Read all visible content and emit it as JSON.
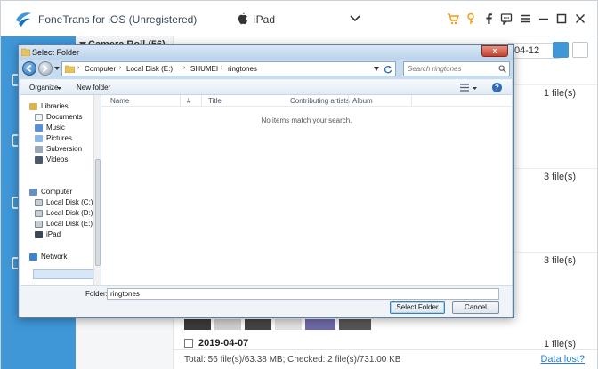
{
  "app": {
    "title": "FoneTrans for iOS (Unregistered)",
    "device": "iPad",
    "accent_color": "#3f97d8",
    "album": "Camera Roll (56)"
  },
  "content": {
    "date_filter": "04-12",
    "file_counts": [
      "1 file(s)",
      "3 file(s)",
      "3 file(s)",
      "1 file(s)"
    ],
    "date_row": "2019-04-07",
    "footer_total": "Total: 56 file(s)/63.38 MB; Checked: 2 file(s)/731.00 KB",
    "data_lost": "Data lost?"
  },
  "dialog": {
    "title": "Select Folder",
    "close_label": "x",
    "breadcrumb": [
      "Computer",
      "Local Disk (E:)",
      "SHUMEI",
      "ringtones"
    ],
    "breadcrumb_separator": "›",
    "search_placeholder": "Search ringtones",
    "toolbar": {
      "organize": "Organize",
      "new_folder": "New folder",
      "help": "?"
    },
    "nav": {
      "libraries": "Libraries",
      "library_items": [
        "Documents",
        "Music",
        "Pictures",
        "Subversion",
        "Videos"
      ],
      "computer": "Computer",
      "drives": [
        "Local Disk (C:)",
        "Local Disk (D:)",
        "Local Disk (E:)",
        "iPad"
      ],
      "selected": "Local Disk (E:)",
      "network": "Network"
    },
    "columns": [
      "Name",
      "#",
      "Title",
      "Contributing artists",
      "Album"
    ],
    "empty_message": "No items match your search.",
    "folder_label": "Folder:",
    "folder_value": "ringtones",
    "select_button": "Select Folder",
    "cancel_button": "Cancel"
  }
}
